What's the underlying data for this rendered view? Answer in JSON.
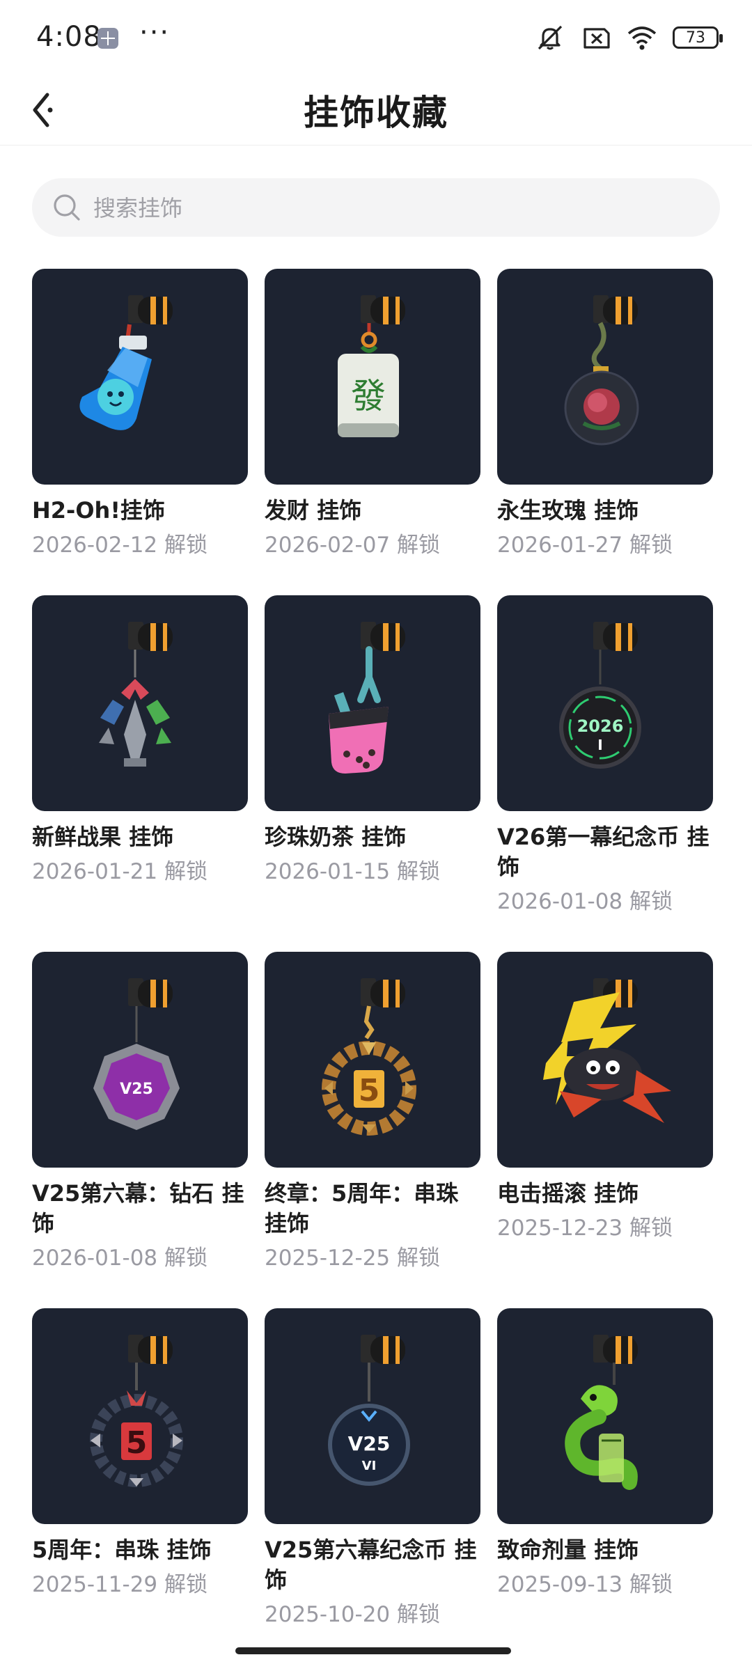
{
  "status_bar": {
    "time": "4:08",
    "more": "···",
    "battery": "73"
  },
  "header": {
    "title": "挂饰收藏"
  },
  "search": {
    "placeholder": "搜索挂饰"
  },
  "items": [
    {
      "title": "H2-Oh!挂饰",
      "date": "2026-02-12 解锁",
      "icon": "water-bottle-charm"
    },
    {
      "title": "发财 挂饰",
      "date": "2026-02-07 解锁",
      "icon": "mahjong-tile-charm"
    },
    {
      "title": "永生玫瑰 挂饰",
      "date": "2026-01-27 解锁",
      "icon": "rose-charm"
    },
    {
      "title": "新鲜战果 挂饰",
      "date": "2026-01-21 解锁",
      "icon": "leaf-trophy-charm"
    },
    {
      "title": "珍珠奶茶 挂饰",
      "date": "2026-01-15 解锁",
      "icon": "bubble-tea-charm"
    },
    {
      "title": "V26第一幕纪念币 挂饰",
      "date": "2026-01-08 解锁",
      "icon": "coin-2026-charm"
    },
    {
      "title": "V25第六幕：钻石 挂饰",
      "date": "2026-01-08 解锁",
      "icon": "diamond-v25-charm"
    },
    {
      "title": "终章：5周年：串珠 挂饰",
      "date": "2025-12-25 解锁",
      "icon": "gold-bead-5-charm"
    },
    {
      "title": "电击摇滚 挂饰",
      "date": "2025-12-23 解锁",
      "icon": "lightning-rock-charm"
    },
    {
      "title": "5周年：串珠 挂饰",
      "date": "2025-11-29 解锁",
      "icon": "red-bead-5-charm"
    },
    {
      "title": "V25第六幕纪念币 挂饰",
      "date": "2025-10-20 解锁",
      "icon": "coin-v25-charm"
    },
    {
      "title": "致命剂量 挂饰",
      "date": "2025-09-13 解锁",
      "icon": "snake-charm"
    }
  ],
  "art": {
    "2026_label": "2026",
    "roman_one": "I",
    "v25_label": "V25",
    "five_label": "5",
    "roman_six": "VI",
    "fa_char": "發"
  },
  "colors": {
    "thumb_bg": "#1d2331",
    "accent_orange": "#f0a030",
    "date_gray": "#9a9aa2"
  }
}
